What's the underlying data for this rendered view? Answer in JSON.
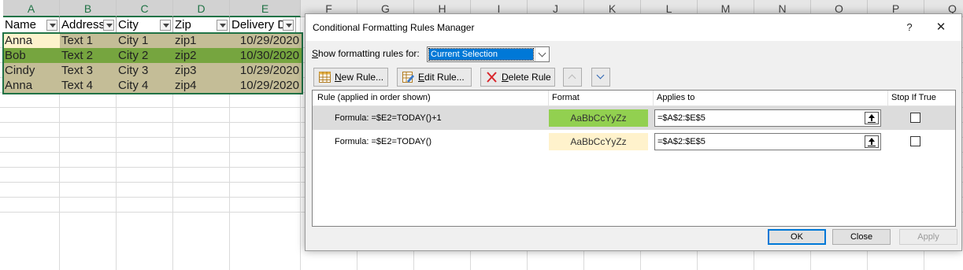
{
  "sheet": {
    "columns": [
      "A",
      "B",
      "C",
      "D",
      "E",
      "F",
      "G",
      "H",
      "I",
      "J",
      "K",
      "L",
      "M",
      "N",
      "O",
      "P",
      "Q"
    ],
    "headers": [
      "Name",
      "Address",
      "City",
      "Zip",
      "Delivery Da"
    ],
    "rows": [
      [
        "Anna",
        "Text 1",
        "City 1",
        "zip1",
        "10/29/2020"
      ],
      [
        "Bob",
        "Text 2",
        "City 2",
        "zip2",
        "10/30/2020"
      ],
      [
        "Cindy",
        "Text 3",
        "City 3",
        "zip3",
        "10/29/2020"
      ],
      [
        "Anna",
        "Text 4",
        "City 4",
        "zip4",
        "10/29/2020"
      ]
    ],
    "colors": {
      "today": "#c4bd97",
      "tomorrow": "#76a53f",
      "header_fill": "#ffffff",
      "name_highlight": "#fdf2cc"
    }
  },
  "dialog": {
    "title": "Conditional Formatting Rules Manager",
    "help": "?",
    "close": "✕",
    "show_label": "Show formatting rules for:",
    "show_value": "Current Selection",
    "toolbar": {
      "new_rule": "New Rule...",
      "edit_rule": "Edit Rule...",
      "delete_rule": "Delete Rule"
    },
    "columns": {
      "rule": "Rule (applied in order shown)",
      "format": "Format",
      "applies": "Applies to",
      "stop": "Stop If True"
    },
    "rules": [
      {
        "formula": "Formula: =$E2=TODAY()+1",
        "preview": "AaBbCcYyZz",
        "preview_color": "#92d050",
        "applies": "=$A$2:$E$5"
      },
      {
        "formula": "Formula: =$E2=TODAY()",
        "preview": "AaBbCcYyZz",
        "preview_color": "#fff2cc",
        "applies": "=$A$2:$E$5"
      }
    ],
    "buttons": {
      "ok": "OK",
      "close": "Close",
      "apply": "Apply"
    }
  }
}
